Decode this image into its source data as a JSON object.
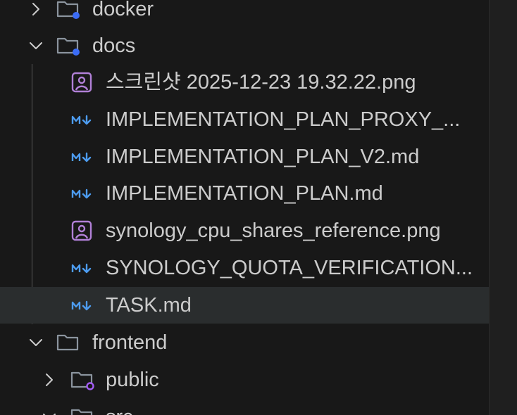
{
  "colors": {
    "background": "#181818",
    "selected_row": "#2a2d2e",
    "text": "#cccccc",
    "folder_icon": "#8b949e",
    "folder_badge_blue": "#3b6cf5",
    "folder_badge_purple": "#a35cf5",
    "image_icon": "#b180d7",
    "markdown_icon": "#4d9cf0"
  },
  "tree": {
    "docker": {
      "label": "docker",
      "icon": "folder-icon",
      "state": "collapsed"
    },
    "docs": {
      "label": "docs",
      "icon": "folder-icon",
      "state": "expanded",
      "files": [
        {
          "label": "스크린샷 2025-12-23 19.32.22.png",
          "icon": "image-file-icon"
        },
        {
          "label": "IMPLEMENTATION_PLAN_PROXY_...",
          "icon": "markdown-file-icon"
        },
        {
          "label": "IMPLEMENTATION_PLAN_V2.md",
          "icon": "markdown-file-icon"
        },
        {
          "label": "IMPLEMENTATION_PLAN.md",
          "icon": "markdown-file-icon"
        },
        {
          "label": "synology_cpu_shares_reference.png",
          "icon": "image-file-icon"
        },
        {
          "label": "SYNOLOGY_QUOTA_VERIFICATION...",
          "icon": "markdown-file-icon"
        },
        {
          "label": "TASK.md",
          "icon": "markdown-file-icon",
          "selected": true
        }
      ]
    },
    "frontend": {
      "label": "frontend",
      "icon": "folder-icon",
      "state": "expanded",
      "children": [
        {
          "label": "public",
          "icon": "folder-icon",
          "state": "collapsed"
        },
        {
          "label": "src",
          "icon": "folder-icon",
          "state": "expanded"
        }
      ]
    }
  }
}
